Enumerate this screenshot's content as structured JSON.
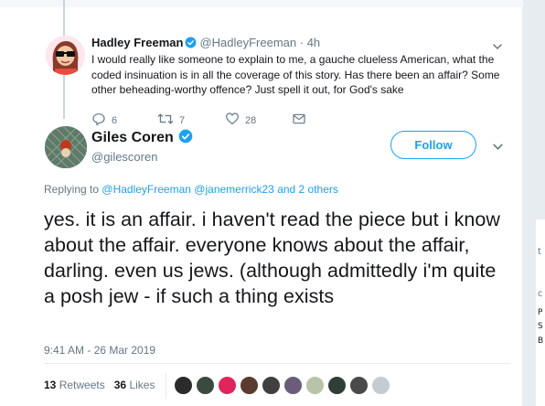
{
  "parent_tweet": {
    "name": "Hadley Freeman",
    "handle": "@HadleyFreeman",
    "time": "· 4h",
    "text": "I would really like someone to explain to me, a gauche clueless American, what the coded insinuation is in all the coverage of this story. Has there been an affair? Some other beheading-worthy offence? Just spell it out, for God's sake",
    "actions": {
      "replies": "6",
      "retweets": "7",
      "likes": "28"
    }
  },
  "main_tweet": {
    "name": "Giles Coren",
    "handle": "@gilescoren",
    "follow_label": "Follow",
    "replying_prefix": "Replying to",
    "replying_mention_1": "@HadleyFreeman",
    "replying_mention_2": "@janemerrick23",
    "replying_suffix": "and 2 others",
    "text": "yes. it is an affair. i haven't read the piece but i know about the affair. everyone knows about the affair, darling. even us jews. (although admittedly i'm quite a posh jew - if such a thing exists",
    "timestamp": "9:41 AM - 26 Mar 2019",
    "retweets_count": "13",
    "retweets_label": "Retweets",
    "likes_count": "36",
    "likes_label": "Likes"
  },
  "side_fragments": {
    "t": "t",
    "c": "c",
    "p": "P",
    "s": "S",
    "b": "B"
  },
  "liker_colors": [
    "#2b2b2b",
    "#3a4a3e",
    "#e0245e",
    "#5a3b2e",
    "#404040",
    "#6b5d7a",
    "#b8c4a8",
    "#2f3f35",
    "#4a4a4a",
    "#c4ccd2"
  ],
  "colors": {
    "accent": "#1da1f2",
    "text": "#14171a",
    "muted": "#657786",
    "like_red": "#e0245e"
  }
}
